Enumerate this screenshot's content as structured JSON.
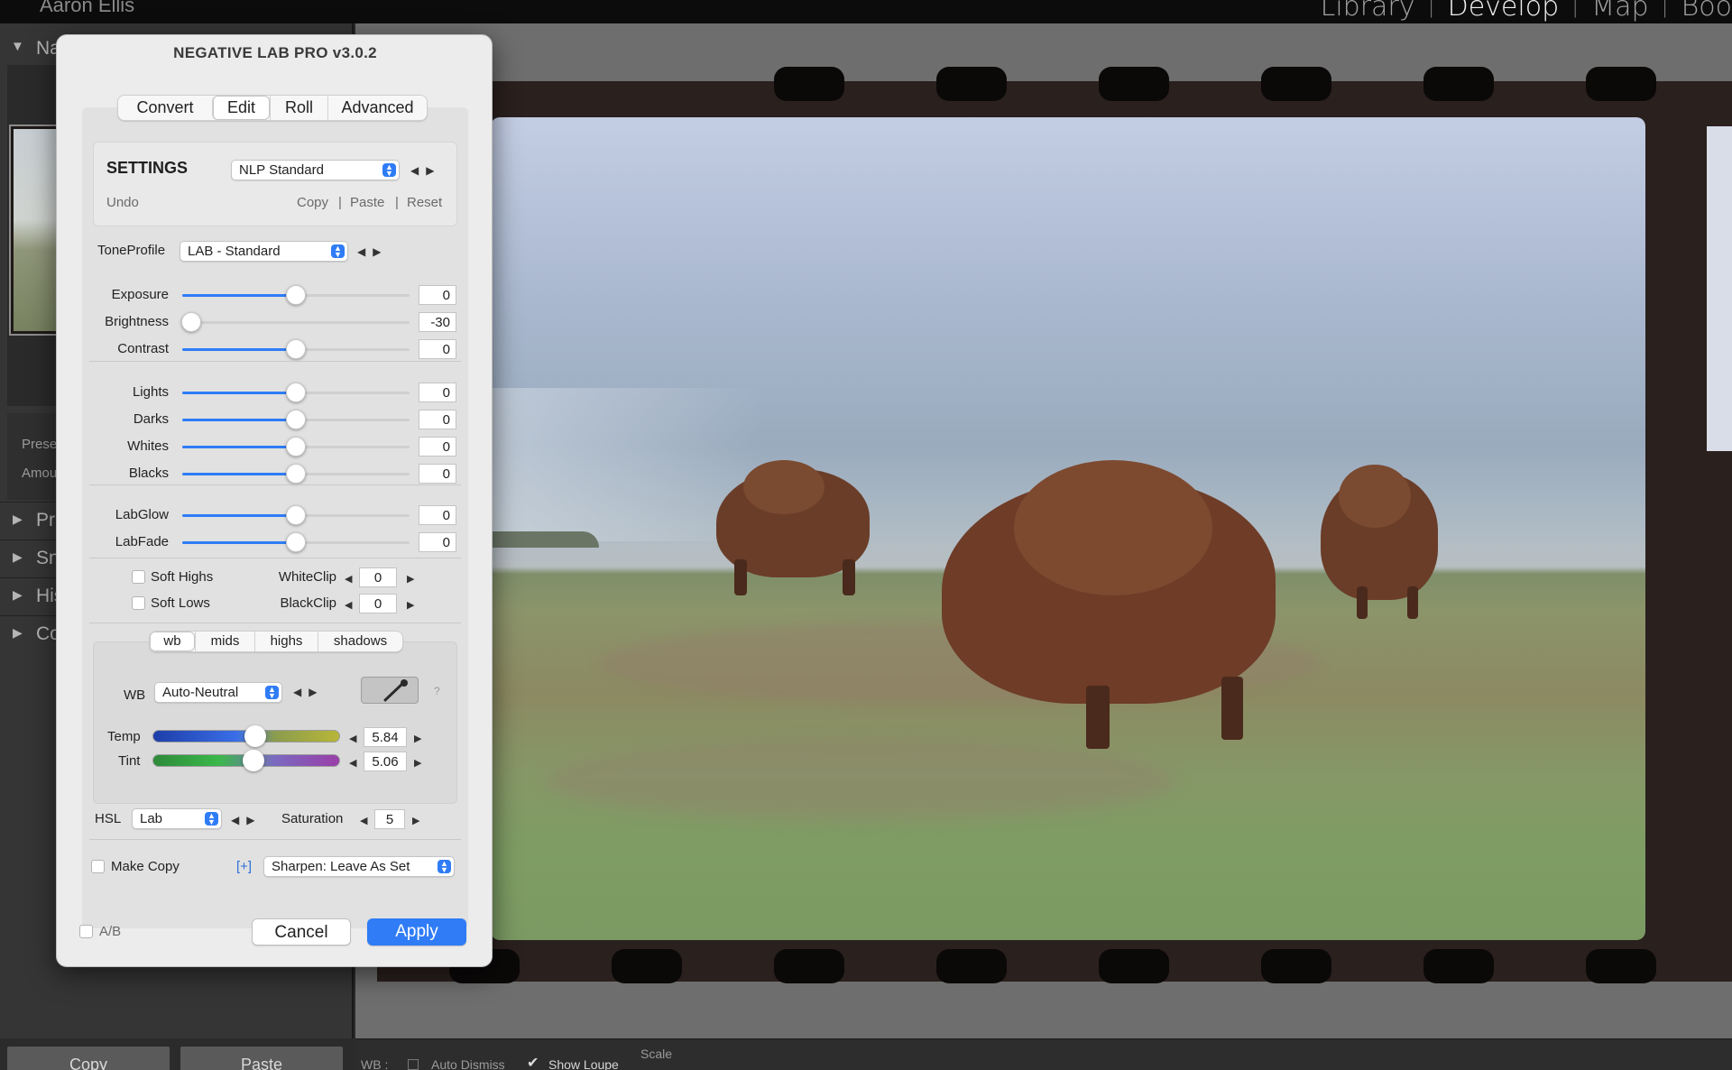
{
  "lightroom": {
    "user_name": "Aaron Ellis",
    "modules": {
      "library": "Library",
      "develop": "Develop",
      "map": "Map",
      "book": "Boo"
    },
    "left_panel": {
      "navigator_label": "Na",
      "presets_label": "Prese",
      "amount_label": "Amou",
      "rows": [
        "Pr",
        "Sn",
        "His",
        "Co"
      ],
      "copy_button": "Copy",
      "paste_button": "Paste"
    },
    "toolbar": {
      "wb_label": "WB :",
      "auto_dismiss": "Auto Dismiss",
      "show_loupe": "Show Loupe",
      "scale": "Scale"
    }
  },
  "dialog": {
    "title": "NEGATIVE LAB PRO v3.0.2",
    "tabs": [
      {
        "label": "Convert",
        "active": false
      },
      {
        "label": "Edit",
        "active": true
      },
      {
        "label": "Roll",
        "active": false
      },
      {
        "label": "Advanced",
        "active": false
      }
    ],
    "settings": {
      "heading": "SETTINGS",
      "preset_value": "NLP Standard",
      "undo": "Undo",
      "copy": "Copy",
      "paste": "Paste",
      "reset": "Reset",
      "sep": "|"
    },
    "tone_profile": {
      "label": "ToneProfile",
      "value": "LAB - Standard"
    },
    "sliders_main": [
      {
        "label": "Exposure",
        "value": "0",
        "position": 0.5
      },
      {
        "label": "Brightness",
        "value": "-30",
        "position": 0.04
      },
      {
        "label": "Contrast",
        "value": "0",
        "position": 0.5
      }
    ],
    "sliders_tone": [
      {
        "label": "Lights",
        "value": "0",
        "position": 0.5
      },
      {
        "label": "Darks",
        "value": "0",
        "position": 0.5
      },
      {
        "label": "Whites",
        "value": "0",
        "position": 0.5
      },
      {
        "label": "Blacks",
        "value": "0",
        "position": 0.5
      }
    ],
    "sliders_lab": [
      {
        "label": "LabGlow",
        "value": "0",
        "position": 0.5
      },
      {
        "label": "LabFade",
        "value": "0",
        "position": 0.5
      }
    ],
    "soft_highs": "Soft Highs",
    "soft_lows": "Soft Lows",
    "white_clip": {
      "label": "WhiteClip",
      "value": "0"
    },
    "black_clip": {
      "label": "BlackClip",
      "value": "0"
    },
    "color_tabs": [
      {
        "label": "wb",
        "active": true
      },
      {
        "label": "mids",
        "active": false
      },
      {
        "label": "highs",
        "active": false
      },
      {
        "label": "shadows",
        "active": false
      }
    ],
    "wb": {
      "label": "WB",
      "value": "Auto-Neutral",
      "help": "?"
    },
    "temp": {
      "label": "Temp",
      "value": "5.84",
      "position": 0.55
    },
    "tint": {
      "label": "Tint",
      "value": "5.06",
      "position": 0.54
    },
    "hsl": {
      "label": "HSL",
      "value": "Lab"
    },
    "saturation": {
      "label": "Saturation",
      "value": "5"
    },
    "make_copy": "Make Copy",
    "plus": "[+]",
    "sharpen": "Sharpen: Leave As Set",
    "ab": "A/B",
    "cancel": "Cancel",
    "apply": "Apply"
  },
  "colors": {
    "accent": "#2f7cf6",
    "dialog_bg": "#ececec",
    "panel_bg": "#e1e1e1"
  }
}
